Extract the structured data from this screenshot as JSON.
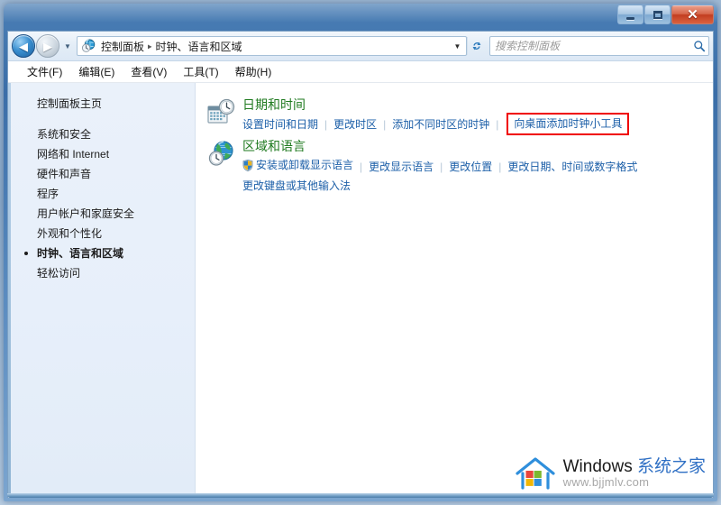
{
  "window": {
    "title": "",
    "buttons": {
      "minimize": "最小化",
      "maximize": "最大化",
      "close": "✕"
    }
  },
  "navbar": {
    "back_label": "◀",
    "forward_label": "▶",
    "recent_label": "▾",
    "dropdown_label": "▼",
    "refresh_label": "↯",
    "breadcrumb": [
      "控制面板",
      "时钟、语言和区域"
    ],
    "breadcrumb_separator": "▸"
  },
  "search": {
    "placeholder": "搜索控制面板",
    "value": ""
  },
  "menubar": {
    "items": [
      {
        "label": "文件(F)"
      },
      {
        "label": "编辑(E)"
      },
      {
        "label": "查看(V)"
      },
      {
        "label": "工具(T)"
      },
      {
        "label": "帮助(H)"
      }
    ]
  },
  "sidebar": {
    "home": "控制面板主页",
    "items": [
      {
        "label": "系统和安全",
        "selected": false
      },
      {
        "label": "网络和 Internet",
        "selected": false
      },
      {
        "label": "硬件和声音",
        "selected": false
      },
      {
        "label": "程序",
        "selected": false
      },
      {
        "label": "用户帐户和家庭安全",
        "selected": false
      },
      {
        "label": "外观和个性化",
        "selected": false
      },
      {
        "label": "时钟、语言和区域",
        "selected": true
      },
      {
        "label": "轻松访问",
        "selected": false
      }
    ]
  },
  "content": {
    "groups": [
      {
        "icon": "calendar-clock-icon",
        "title": "日期和时间",
        "links": [
          {
            "label": "设置时间和日期",
            "shield": false,
            "highlighted": false
          },
          {
            "label": "更改时区",
            "shield": false,
            "highlighted": false
          },
          {
            "label": "添加不同时区的时钟",
            "shield": false,
            "highlighted": false
          },
          {
            "label": "向桌面添加时钟小工具",
            "shield": false,
            "highlighted": true
          }
        ],
        "sublinks": []
      },
      {
        "icon": "globe-clock-icon",
        "title": "区域和语言",
        "links": [
          {
            "label": "安装或卸载显示语言",
            "shield": true,
            "highlighted": false
          },
          {
            "label": "更改显示语言",
            "shield": false,
            "highlighted": false
          },
          {
            "label": "更改位置",
            "shield": false,
            "highlighted": false
          },
          {
            "label": "更改日期、时间或数字格式",
            "shield": false,
            "highlighted": false
          }
        ],
        "sublinks": [
          {
            "label": "更改键盘或其他输入法",
            "shield": false,
            "highlighted": false
          }
        ]
      }
    ]
  },
  "watermark": {
    "brand_en": "Windows ",
    "brand_cn": "系统之家",
    "url": "www.bjjmlv.com"
  },
  "colors": {
    "section_title": "#1f7a1f",
    "link": "#1c5fa8",
    "highlight_box": "#f00000",
    "sidebar_bg": "#eaf1fa",
    "titlebar_blue": "#3b6ea8",
    "close_red": "#c23d20"
  }
}
